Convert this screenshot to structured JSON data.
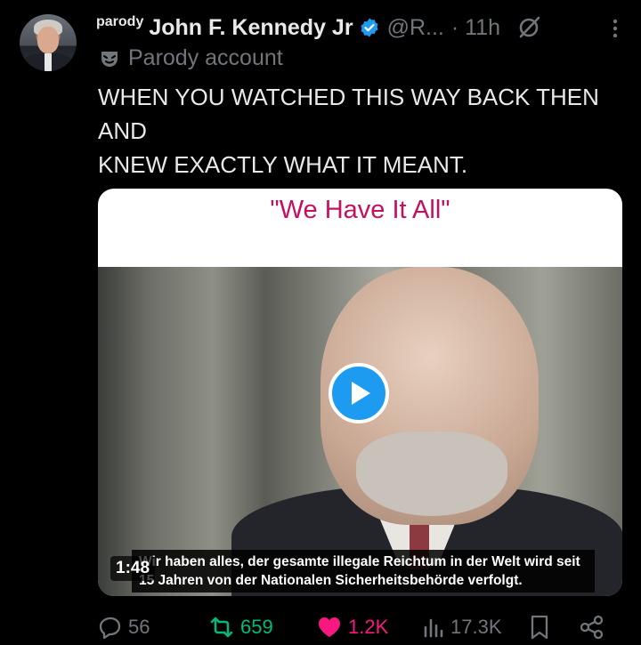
{
  "post": {
    "parody_badge": "parody",
    "display_name": "John F. Kennedy Jr",
    "handle": "@R...",
    "time": "· 11h",
    "parody_label": "Parody account",
    "text": "WHEN YOU WATCHED THIS WAY BACK THEN\nAND\nKNEW EXACTLY WHAT IT MEANT."
  },
  "media": {
    "video_title": "\"We Have It All\"",
    "subtitle": "Wir haben alles, der gesamte illegale Reichtum in der Welt wird seit 15 Jahren von der Nationalen Sicherheitsbehörde verfolgt.",
    "duration": "1:48"
  },
  "actions": {
    "replies": "56",
    "reposts": "659",
    "likes": "1.2K",
    "views": "17.3K"
  },
  "colors": {
    "background": "#000000",
    "verified": "#1d9bf0",
    "repost": "#00ba7c",
    "like": "#f91880",
    "video_title": "#c3105f"
  },
  "icons": [
    "verified-icon",
    "grok-icon",
    "more-icon",
    "parody-mask-icon",
    "play-icon",
    "reply-icon",
    "repost-icon",
    "like-icon",
    "views-icon",
    "bookmark-icon",
    "share-icon"
  ]
}
